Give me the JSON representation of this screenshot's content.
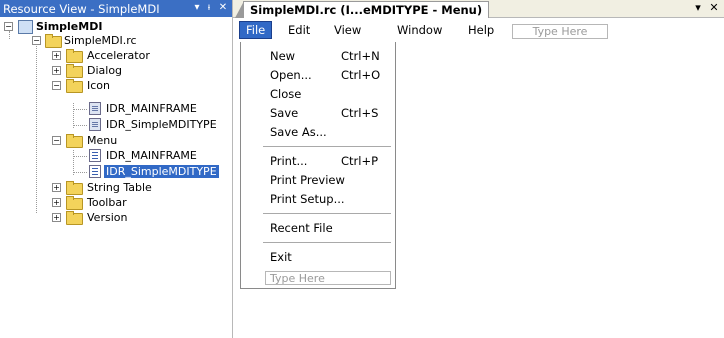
{
  "resource_view": {
    "title": "Resource View - SimpleMDI",
    "pin_label": "▾ ⊥",
    "close_label": "✕",
    "tree": {
      "root": "SimpleMDI",
      "rc_file": "SimpleMDI.rc",
      "accelerator": "Accelerator",
      "dialog": "Dialog",
      "icon": "Icon",
      "icon_children": [
        "IDR_MAINFRAME",
        "IDR_SimpleMDITYPE"
      ],
      "menu": "Menu",
      "menu_children": [
        "IDR_MAINFRAME",
        "IDR_SimpleMDITYPE"
      ],
      "string_table": "String Table",
      "toolbar": "Toolbar",
      "version": "Version"
    }
  },
  "editor": {
    "tab_title": "SimpleMDI.rc (I...eMDITYPE - Menu)",
    "tab_dropdown_label": "▾",
    "tab_close_label": "✕",
    "menubar": {
      "file": "File",
      "edit": "Edit",
      "view": "View",
      "window": "Window",
      "help": "Help",
      "type_here": "Type Here"
    },
    "file_menu": {
      "new": "New",
      "new_shortcut": "Ctrl+N",
      "open": "Open...",
      "open_shortcut": "Ctrl+O",
      "close": "Close",
      "save": "Save",
      "save_shortcut": "Ctrl+S",
      "save_as": "Save As...",
      "print": "Print...",
      "print_shortcut": "Ctrl+P",
      "print_preview": "Print Preview",
      "print_setup": "Print Setup...",
      "recent_file": "Recent File",
      "exit": "Exit",
      "type_here": "Type Here"
    }
  },
  "colors": {
    "title_bar": "#3b6fc4",
    "selection": "#3169c6",
    "folder": "#f3d35b"
  }
}
